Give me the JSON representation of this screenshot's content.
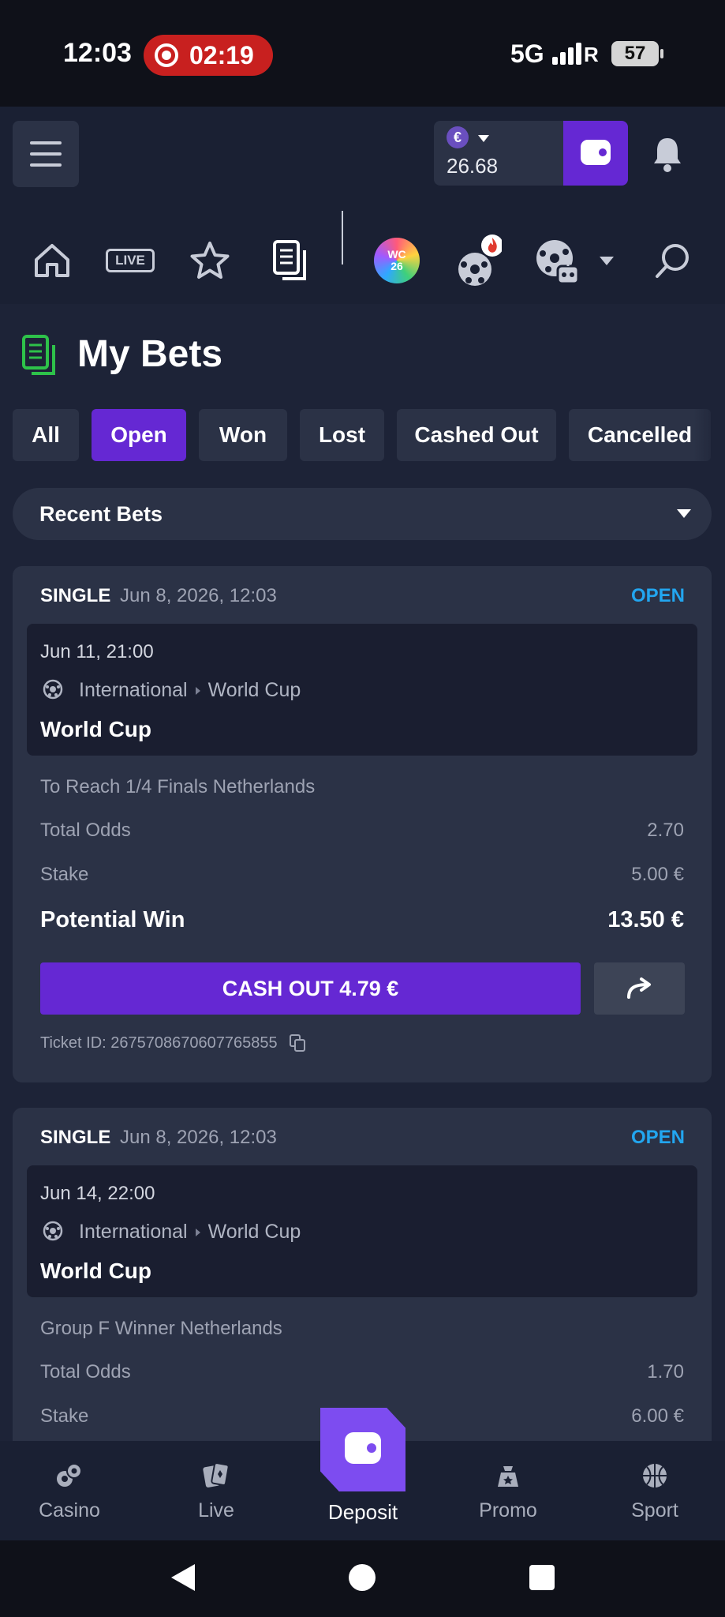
{
  "status_bar": {
    "time": "12:03",
    "recording_time": "02:19",
    "network": "5G",
    "roaming": "R",
    "battery": "57"
  },
  "header": {
    "currency_symbol": "€",
    "balance": "26.68",
    "nav_live_label": "LIVE",
    "wc_badge": "WC 26"
  },
  "page": {
    "title": "My Bets",
    "tabs": [
      {
        "label": "All"
      },
      {
        "label": "Open",
        "active": true
      },
      {
        "label": "Won"
      },
      {
        "label": "Lost"
      },
      {
        "label": "Cashed Out"
      },
      {
        "label": "Cancelled"
      }
    ],
    "filter_label": "Recent Bets"
  },
  "bets": [
    {
      "type": "SINGLE",
      "placed": "Jun 8, 2026, 12:03",
      "status": "OPEN",
      "event_time": "Jun 11, 21:00",
      "category": "International",
      "competition": "World Cup",
      "event_name": "World Cup",
      "market": "To Reach 1/4 Finals Netherlands",
      "odds_label": "Total Odds",
      "odds": "2.70",
      "stake_label": "Stake",
      "stake": "5.00 €",
      "win_label": "Potential Win",
      "win": "13.50 €",
      "cashout_label": "CASH OUT 4.79 €",
      "ticket": "Ticket ID: 2675708670607765855"
    },
    {
      "type": "SINGLE",
      "placed": "Jun 8, 2026, 12:03",
      "status": "OPEN",
      "event_time": "Jun 14, 22:00",
      "category": "International",
      "competition": "World Cup",
      "event_name": "World Cup",
      "market": "Group F Winner Netherlands",
      "odds_label": "Total Odds",
      "odds": "1.70",
      "stake_label": "Stake",
      "stake": "6.00 €"
    }
  ],
  "bottom_nav": {
    "casino": "Casino",
    "live": "Live",
    "deposit": "Deposit",
    "promo": "Promo",
    "sport": "Sport"
  },
  "colors": {
    "accent": "#6528d3",
    "status_open": "#22a6f0",
    "card": "#2b3246",
    "background": "#1d2337"
  }
}
